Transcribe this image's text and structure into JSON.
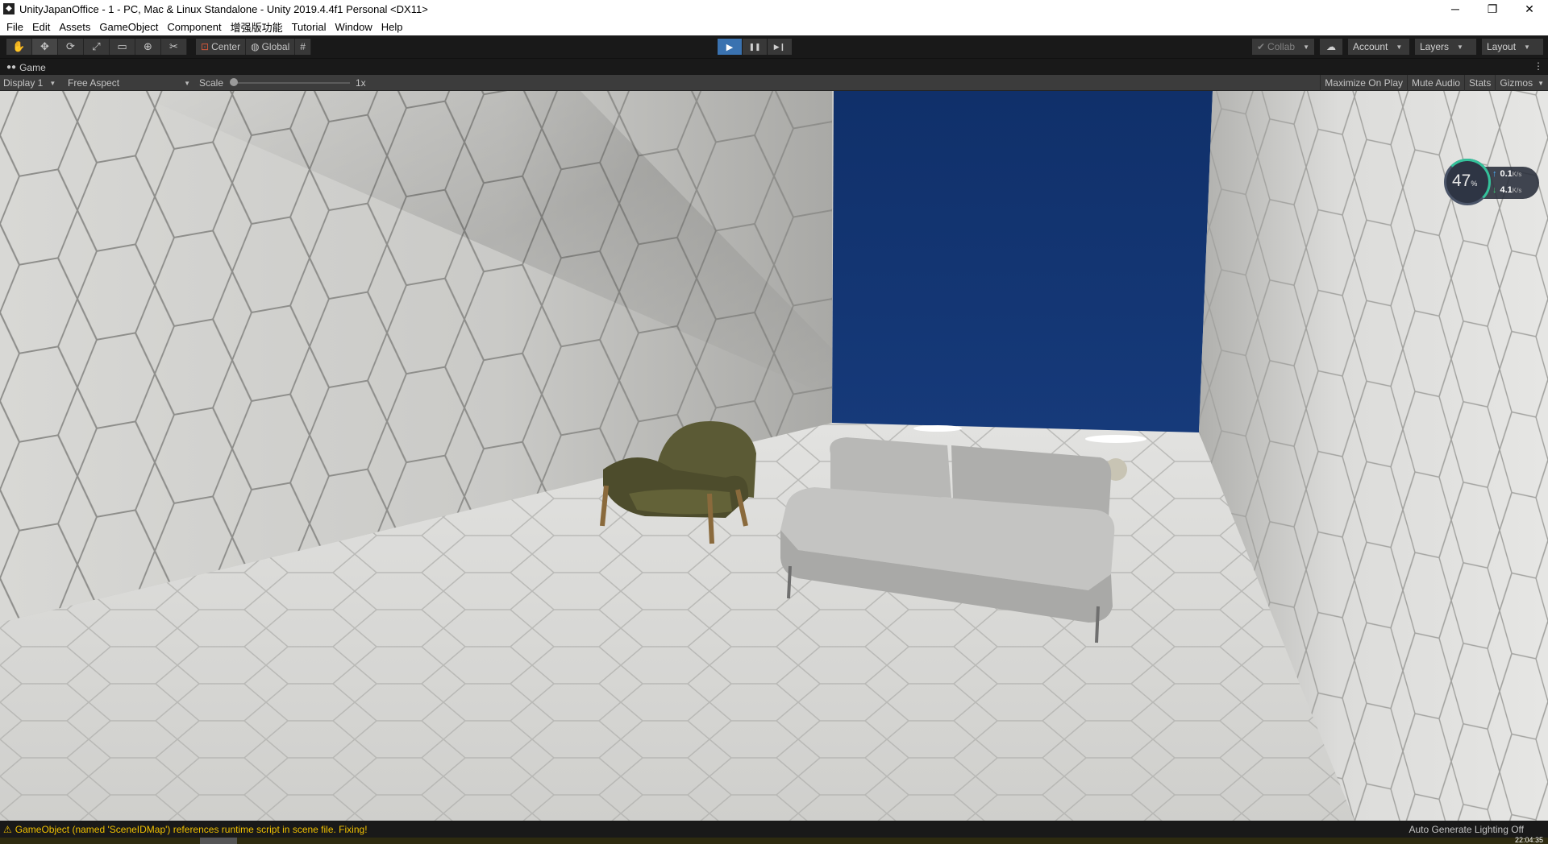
{
  "window": {
    "title": "UnityJapanOffice - 1 - PC, Mac & Linux Standalone - Unity 2019.4.4f1 Personal <DX11>",
    "app_icon": "unity-icon",
    "minimize": "─",
    "restore": "❐",
    "close": "✕"
  },
  "menu": [
    "File",
    "Edit",
    "Assets",
    "GameObject",
    "Component",
    "增强版功能",
    "Tutorial",
    "Window",
    "Help"
  ],
  "toolbar": {
    "tools": [
      {
        "name": "hand-tool",
        "glyph": "✋"
      },
      {
        "name": "move-tool",
        "glyph": "✥"
      },
      {
        "name": "rotate-tool",
        "glyph": "⟳"
      },
      {
        "name": "scale-tool",
        "glyph": "⤢"
      },
      {
        "name": "rect-tool",
        "glyph": "▭"
      },
      {
        "name": "transform-tool",
        "glyph": "⊕"
      },
      {
        "name": "custom-tool",
        "glyph": "✂"
      }
    ],
    "pivot_center": "Center",
    "pivot_global": "Global",
    "grid_snap_glyph": "#",
    "play_glyph": "▶",
    "pause_glyph": "❚❚",
    "step_glyph": "▶❙",
    "collab": "Collab",
    "cloud_glyph": "☁",
    "account": "Account",
    "layers": "Layers",
    "layout": "Layout"
  },
  "game_tab": {
    "label": "Game",
    "menu_glyph": "⋮"
  },
  "game_view_bar": {
    "display": "Display 1",
    "aspect": "Free Aspect",
    "scale_label": "Scale",
    "scale_value": "1x",
    "maximize": "Maximize On Play",
    "mute": "Mute Audio",
    "stats": "Stats",
    "gizmos": "Gizmos"
  },
  "net_monitor": {
    "cpu_percent": "47",
    "percent_sign": "%",
    "upload": "0.1",
    "download": "4.1",
    "unit": "K/s",
    "up_glyph": "↑",
    "down_glyph": "↓"
  },
  "status": {
    "warning_glyph": "⚠",
    "message": "GameObject (named 'SceneIDMap') references runtime script in scene file. Fixing!",
    "lighting": "Auto Generate Lighting Off",
    "clock": "22:04:35"
  },
  "colors": {
    "accent_play": "#3a72b0",
    "warning": "#f0c000",
    "back_wall": "#123268",
    "editor_bg": "#191919"
  }
}
